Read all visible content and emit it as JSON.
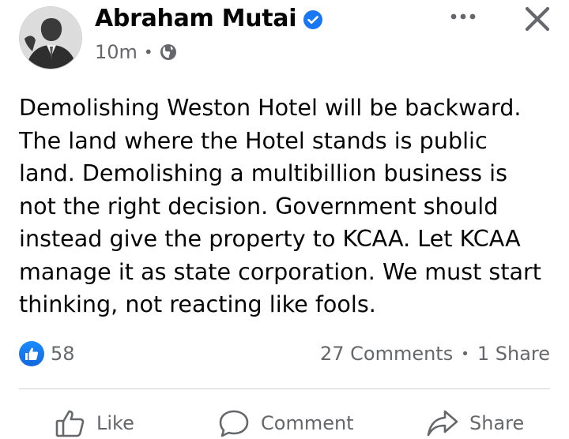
{
  "post": {
    "author": "Abraham Mutai",
    "timestamp": "10m",
    "meta_separator": "•",
    "privacy_icon": "globe-icon",
    "verified_icon": "verified-badge-icon",
    "text_lines": [
      "Demolishing Weston Hotel will be backward.",
      "The land where the Hotel stands is public",
      "land. Demolishing a multibillion business is",
      "not the right decision. Government should",
      "instead give the property to KCAA. Let KCAA",
      "manage it as state corporation. We must start",
      "thinking, not reacting like fools."
    ]
  },
  "header_actions": {
    "more_icon": "more-options-icon",
    "close_icon": "close-icon"
  },
  "engagement": {
    "reaction_icon": "like-reaction-icon",
    "reaction_count": "58",
    "comments": "27 Comments",
    "separator": "•",
    "shares": "1 Share"
  },
  "actions": {
    "like_label": "Like",
    "comment_label": "Comment",
    "share_label": "Share"
  },
  "colors": {
    "accent": "#1877f2",
    "secondary_text": "#65676b",
    "primary_text": "#050505",
    "divider": "#ced0d4"
  }
}
